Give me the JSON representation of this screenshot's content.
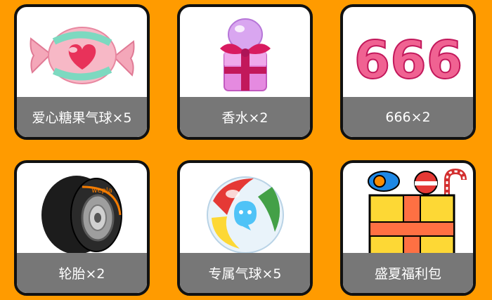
{
  "page": {
    "background": "#FF9B00"
  },
  "items": [
    {
      "label": "爱心糖果气球×5",
      "icon": "heart-candy-balloon-icon"
    },
    {
      "label": "香水×2",
      "icon": "perfume-gift-icon"
    },
    {
      "label": "666×2",
      "icon": "666-balloon-icon",
      "art_text": "666"
    },
    {
      "label": "轮胎×2",
      "icon": "racing-tire-icon",
      "tire_brand": "wepla"
    },
    {
      "label": "专属气球×5",
      "icon": "exclusive-balloon-icon"
    },
    {
      "label": "盛夏福利包",
      "icon": "summer-gift-box-icon"
    }
  ]
}
